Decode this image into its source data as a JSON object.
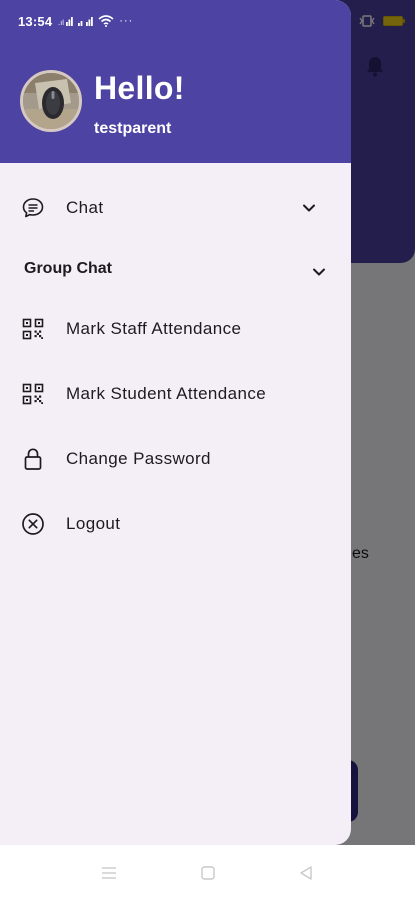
{
  "status_bar": {
    "time": "13:54",
    "icons": [
      "signal-icon",
      "signal-icon",
      "wifi-icon",
      "more-dots-icon",
      "vibrate-icon",
      "battery-icon"
    ],
    "more": "···"
  },
  "drawer": {
    "greeting": "Hello!",
    "username": "testparent",
    "items": [
      {
        "label": "Chat",
        "icon": "chat-bubble-icon",
        "expandable": true
      },
      {
        "label": "Group Chat",
        "icon": "",
        "expandable": true
      },
      {
        "label": "Mark Staff Attendance",
        "icon": "qr-code-icon",
        "expandable": false
      },
      {
        "label": "Mark Student Attendance",
        "icon": "qr-code-icon",
        "expandable": false
      },
      {
        "label": "Change Password",
        "icon": "lock-icon",
        "expandable": false
      },
      {
        "label": "Logout",
        "icon": "close-circle-icon",
        "expandable": false
      }
    ]
  },
  "background": {
    "partial_text": "es"
  },
  "colors": {
    "header": "#4d43a3",
    "drawer_bg": "#f4eff7",
    "text": "#1d1b20",
    "scrim": "rgba(0,0,0,0.52)"
  },
  "system_nav": {
    "buttons": [
      "menu-icon",
      "home-square-icon",
      "back-triangle-icon"
    ]
  }
}
